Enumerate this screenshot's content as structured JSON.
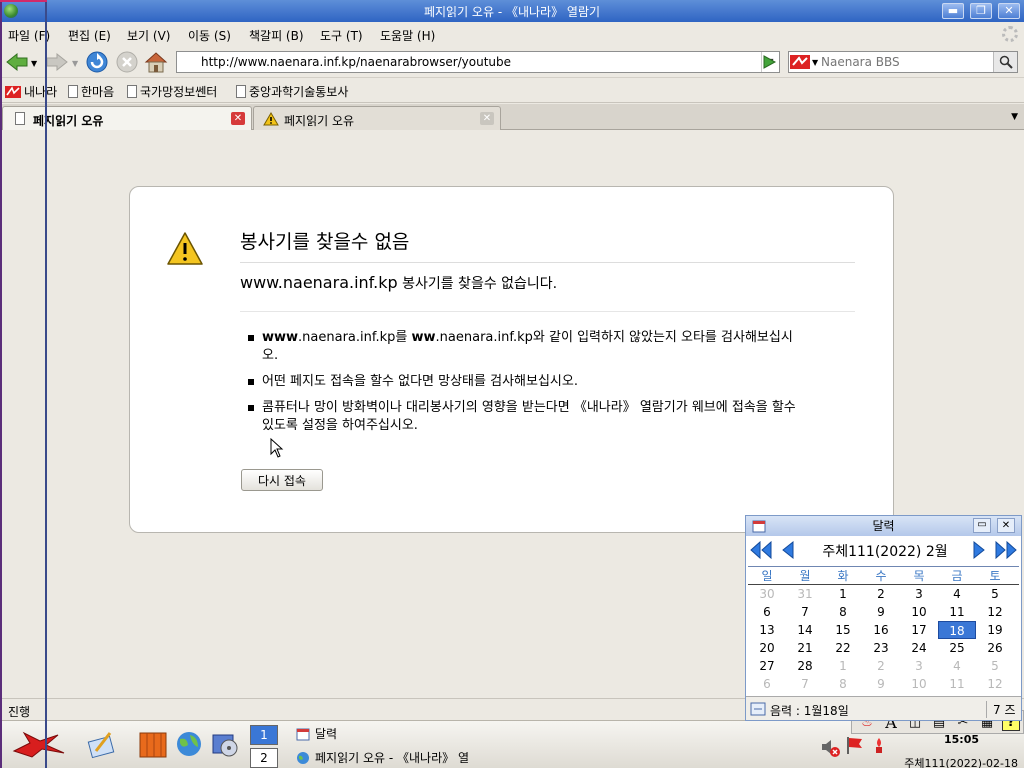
{
  "window": {
    "title": "페지읽기 오유 - 《내나라》 열람기",
    "buttons": {
      "minimize": "▬",
      "maximize": "❐",
      "close": "✕"
    }
  },
  "menu": [
    "파일 (F)",
    "편집 (E)",
    "보기 (V)",
    "이동 (S)",
    "책갈피 (B)",
    "도구 (T)",
    "도움말 (H)"
  ],
  "navbar": {
    "url": "http://www.naenara.inf.kp/naenarabrowser/youtube",
    "search_placeholder": "Naenara BBS"
  },
  "bookmarks": [
    "내나라",
    "한마음",
    "국가망정보쎈터",
    "중앙과학기술통보사"
  ],
  "tabs": [
    {
      "label": "페지읽기 오유",
      "active": true
    },
    {
      "label": "페지읽기 오유",
      "active": false
    }
  ],
  "error": {
    "heading": "봉사기를 찾을수 없음",
    "desc_host": "www.naenara.inf.kp",
    "desc_text": " 봉사기를 찾을수 없습니다.",
    "items": [
      {
        "b1": "www",
        "t1": ".naenara.inf.kp를 ",
        "b2": "ww",
        "t2": ".naenara.inf.kp와 같이 입력하지 않았는지 오타를 검사해보십시오."
      },
      {
        "t1": "어떤 페지도 접속을 할수 없다면 망상태를 검사해보십시오."
      },
      {
        "t1": "콤퓨터나 망이 방화벽이나 대리봉사기의 영향을 받는다면 《내나라》 열람기가 웨브에 접속을 할수 있도록 설정을 하여주십시오."
      }
    ],
    "retry_label": "다시 접속"
  },
  "status": "진행",
  "calendar": {
    "title": "달력",
    "month_label": "주체111(2022)  2월",
    "weekdays": [
      "일",
      "월",
      "화",
      "수",
      "목",
      "금",
      "토"
    ],
    "weeks": [
      [
        {
          "d": "30",
          "o": true
        },
        {
          "d": "31",
          "o": true
        },
        {
          "d": "1"
        },
        {
          "d": "2"
        },
        {
          "d": "3"
        },
        {
          "d": "4"
        },
        {
          "d": "5"
        }
      ],
      [
        {
          "d": "6"
        },
        {
          "d": "7"
        },
        {
          "d": "8"
        },
        {
          "d": "9"
        },
        {
          "d": "10"
        },
        {
          "d": "11"
        },
        {
          "d": "12"
        }
      ],
      [
        {
          "d": "13"
        },
        {
          "d": "14"
        },
        {
          "d": "15"
        },
        {
          "d": "16"
        },
        {
          "d": "17"
        },
        {
          "d": "18",
          "t": true
        },
        {
          "d": "19"
        }
      ],
      [
        {
          "d": "20"
        },
        {
          "d": "21"
        },
        {
          "d": "22"
        },
        {
          "d": "23"
        },
        {
          "d": "24"
        },
        {
          "d": "25"
        },
        {
          "d": "26"
        }
      ],
      [
        {
          "d": "27"
        },
        {
          "d": "28"
        },
        {
          "d": "1",
          "o": true
        },
        {
          "d": "2",
          "o": true
        },
        {
          "d": "3",
          "o": true
        },
        {
          "d": "4",
          "o": true
        },
        {
          "d": "5",
          "o": true
        }
      ],
      [
        {
          "d": "6",
          "o": true
        },
        {
          "d": "7",
          "o": true
        },
        {
          "d": "8",
          "o": true
        },
        {
          "d": "9",
          "o": true
        },
        {
          "d": "10",
          "o": true
        },
        {
          "d": "11",
          "o": true
        },
        {
          "d": "12",
          "o": true
        }
      ]
    ],
    "lunar": "음력 : 1월18일",
    "side_label": "7 즈"
  },
  "taskbar": {
    "workspace_1": "1",
    "workspace_2": "2",
    "task_calendar": "달력",
    "task_browser": "페지읽기 오유 - 《내나라》 열",
    "clock": "15:05",
    "date": "주체111(2022)-02-18"
  },
  "colors": {
    "titlebar": "#2f64c3",
    "today": "#3a77d6",
    "weekday": "#3a77c4"
  }
}
